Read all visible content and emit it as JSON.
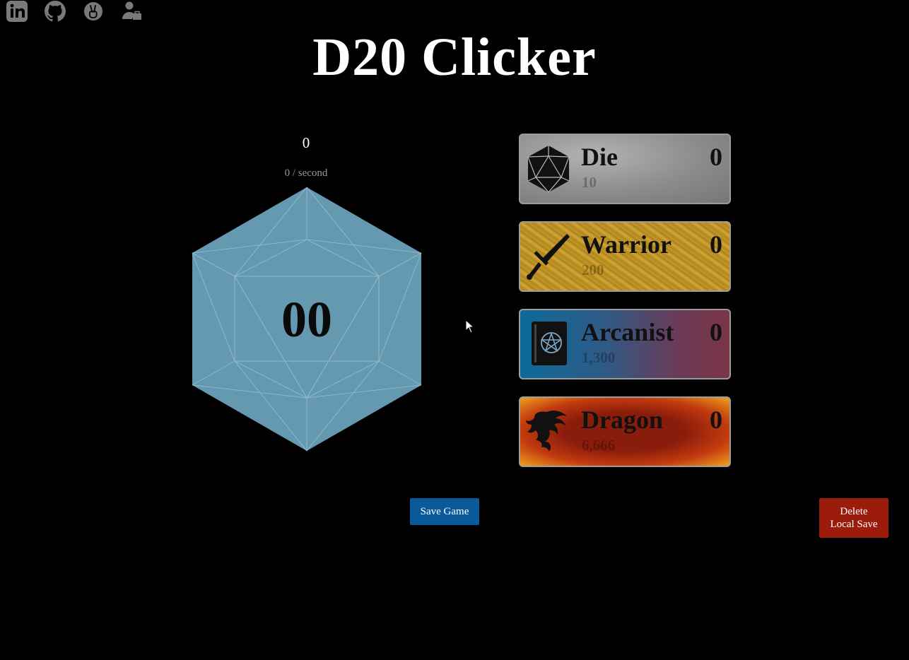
{
  "social": {
    "links": [
      {
        "icon": "linkedin-icon"
      },
      {
        "icon": "github-icon"
      },
      {
        "icon": "peace-hand-icon"
      },
      {
        "icon": "portfolio-person-icon"
      }
    ]
  },
  "title": "D20 Clicker",
  "stats": {
    "total": "0",
    "rate": "0 / second"
  },
  "d20": {
    "value": "00",
    "color": "#6599b0"
  },
  "store": {
    "items": [
      {
        "name": "Die",
        "count": "0",
        "cost": "10",
        "icon": "d20-icon"
      },
      {
        "name": "Warrior",
        "count": "0",
        "cost": "200",
        "icon": "sword-icon"
      },
      {
        "name": "Arcanist",
        "count": "0",
        "cost": "1,300",
        "icon": "spellbook-icon"
      },
      {
        "name": "Dragon",
        "count": "0",
        "cost": "6,666",
        "icon": "dragon-icon"
      }
    ]
  },
  "buttons": {
    "save": "Save Game",
    "delete_line1": "Delete",
    "delete_line2": "Local Save"
  },
  "colors": {
    "background": "#000000",
    "save_button": "#0a5a9a",
    "delete_button": "#9c1c0c"
  }
}
